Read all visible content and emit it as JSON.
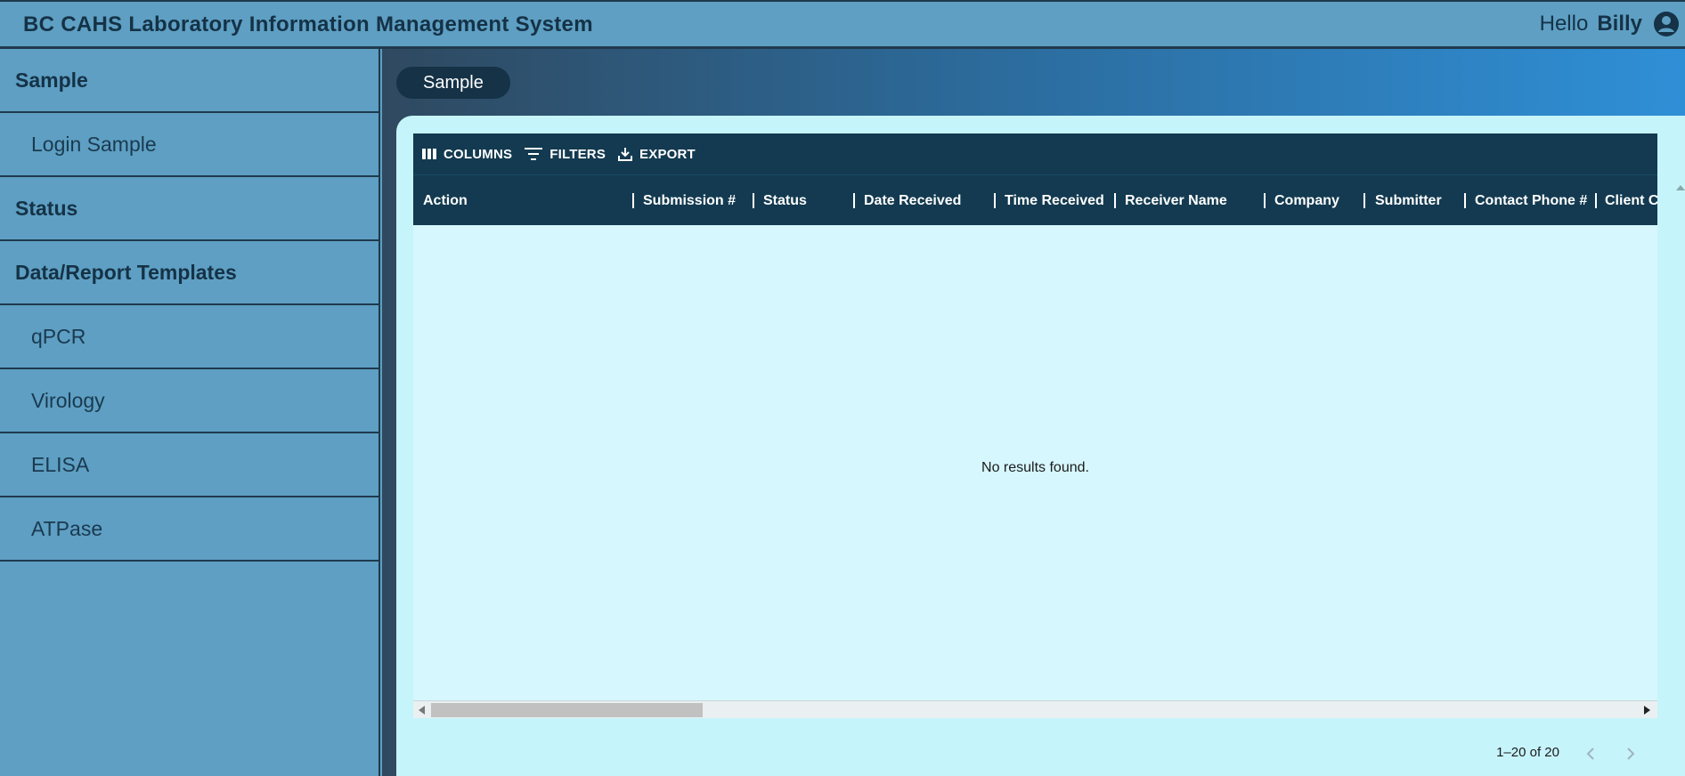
{
  "header": {
    "title": "BC CAHS Laboratory Information Management System",
    "greeting": "Hello",
    "username": "Billy"
  },
  "sidebar": {
    "items": [
      {
        "label": "Sample",
        "type": "section"
      },
      {
        "label": "Login Sample",
        "type": "sub"
      },
      {
        "label": "Status",
        "type": "section"
      },
      {
        "label": "Data/Report Templates",
        "type": "section"
      },
      {
        "label": "qPCR",
        "type": "sub"
      },
      {
        "label": "Virology",
        "type": "sub"
      },
      {
        "label": "ELISA",
        "type": "sub"
      },
      {
        "label": "ATPase",
        "type": "sub"
      }
    ]
  },
  "main": {
    "breadcrumb": "Sample"
  },
  "grid": {
    "toolbar": {
      "columns_label": "COLUMNS",
      "filters_label": "FILTERS",
      "export_label": "EXPORT"
    },
    "columns": [
      "Action",
      "Submission #",
      "Status",
      "Date Received",
      "Time Received",
      "Receiver Name",
      "Company",
      "Submitter",
      "Contact Phone #",
      "Client Ca"
    ],
    "empty_message": "No results found.",
    "pagination": {
      "range_text": "1–20 of 20"
    }
  },
  "colors": {
    "header_bg": "#5e9fc3",
    "dark_navy": "#133a50",
    "panel_bg": "#c6f4fb",
    "grid_bg": "#d6f7fd"
  }
}
